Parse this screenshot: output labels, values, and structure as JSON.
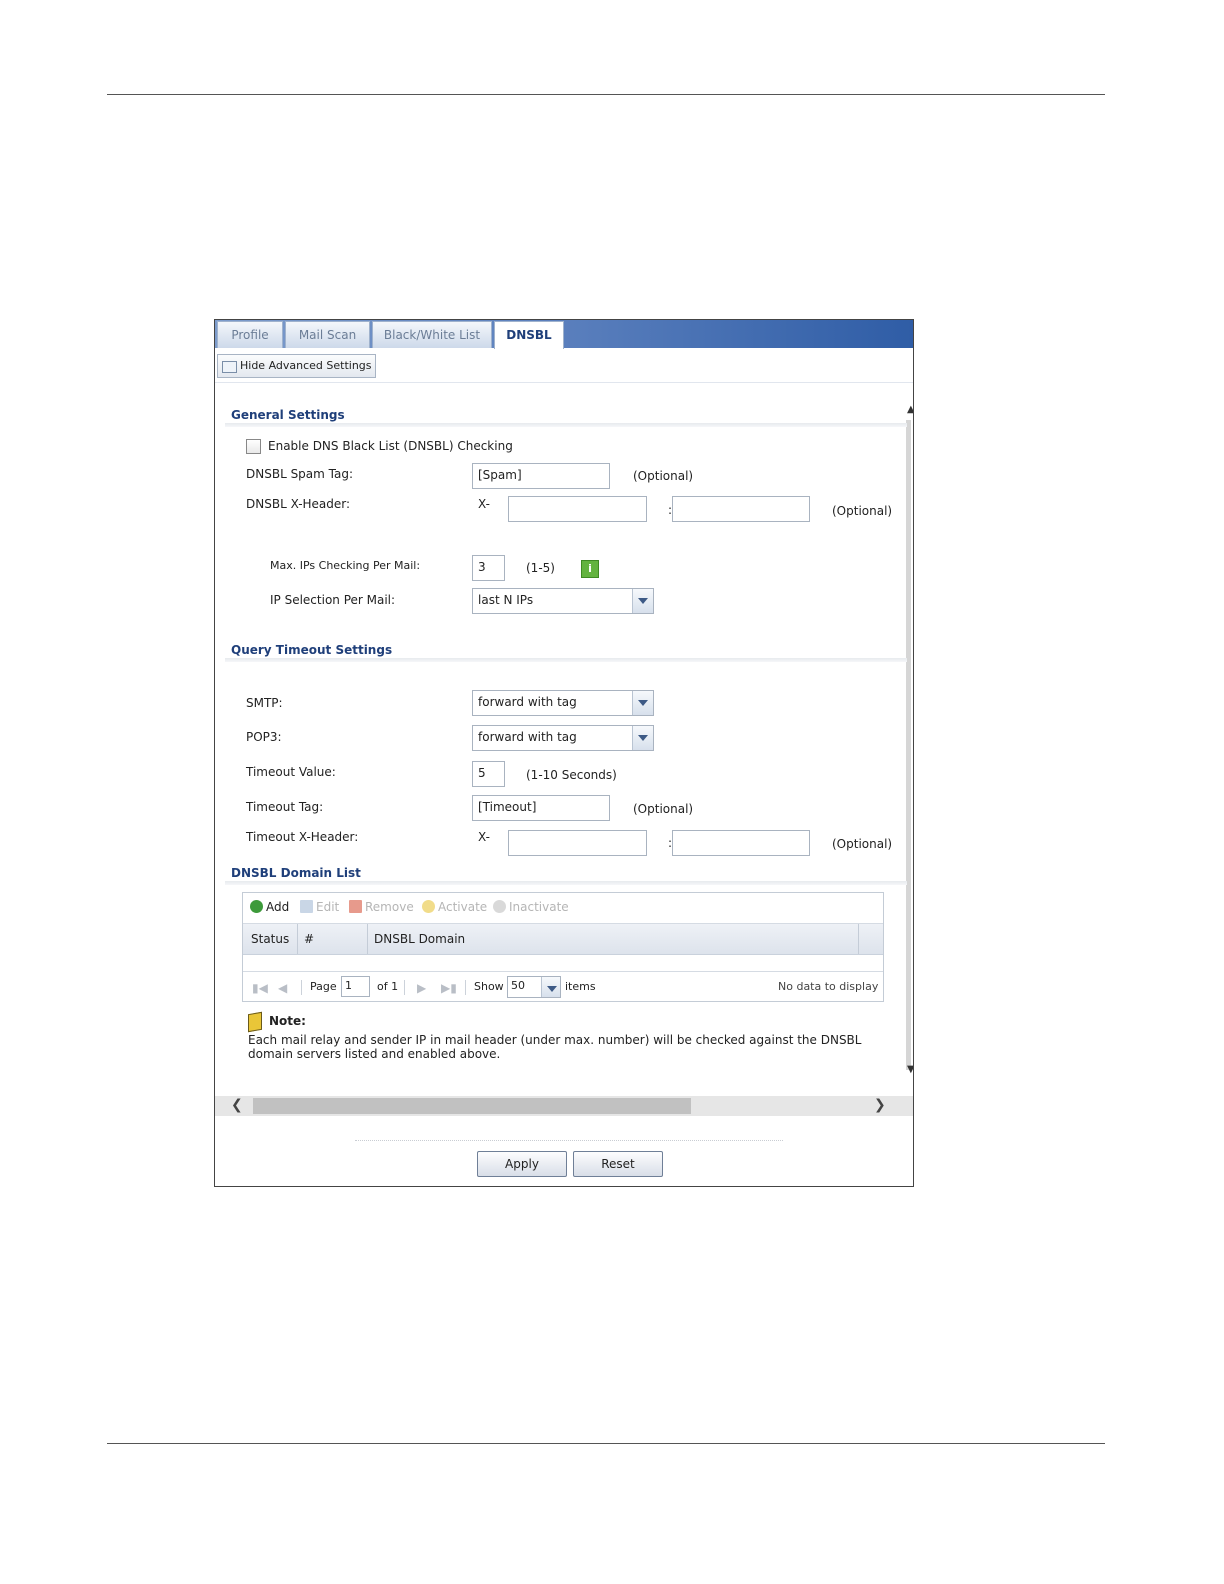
{
  "tabs": [
    {
      "label": "Profile"
    },
    {
      "label": "Mail Scan"
    },
    {
      "label": "Black/White List"
    },
    {
      "label": "DNSBL",
      "active": true
    }
  ],
  "toolbar": {
    "advanced_label": "Hide Advanced Settings"
  },
  "general": {
    "title": "General Settings",
    "enable_label": "Enable DNS Black List (DNSBL) Checking",
    "enable_checked": false,
    "spam_tag_label": "DNSBL Spam Tag:",
    "spam_tag_value": "[Spam]",
    "spam_tag_hint": "(Optional)",
    "xheader_label": "DNSBL X-Header:",
    "xheader_prefix": "X-",
    "xheader_name": "",
    "xheader_sep": ":",
    "xheader_value": "",
    "xheader_hint": "(Optional)",
    "max_ips_label": "Max. IPs Checking Per Mail:",
    "max_ips_value": "3",
    "max_ips_hint": "(1-5)",
    "info_icon_glyph": "i",
    "ip_selection_label": "IP Selection Per Mail:",
    "ip_selection_value": "last N IPs"
  },
  "timeout": {
    "title": "Query Timeout Settings",
    "smtp_label": "SMTP:",
    "smtp_value": "forward with tag",
    "pop3_label": "POP3:",
    "pop3_value": "forward with tag",
    "timeout_value_label": "Timeout Value:",
    "timeout_value": "5",
    "timeout_value_hint": "(1-10 Seconds)",
    "timeout_tag_label": "Timeout Tag:",
    "timeout_tag_value": "[Timeout]",
    "timeout_tag_hint": "(Optional)",
    "xheader_label": "Timeout X-Header:",
    "xheader_prefix": "X-",
    "xheader_name": "",
    "xheader_sep": ":",
    "xheader_value": "",
    "xheader_hint": "(Optional)"
  },
  "domain_list": {
    "title": "DNSBL Domain List",
    "tools": {
      "add": "Add",
      "edit": "Edit",
      "remove": "Remove",
      "activate": "Activate",
      "inactivate": "Inactivate"
    },
    "columns": [
      "Status",
      "#",
      "DNSBL Domain"
    ],
    "rows": [],
    "pager": {
      "page_label": "Page",
      "page_value": "1",
      "of_label": "of 1",
      "show_label": "Show",
      "show_value": "50",
      "items_label": "items",
      "empty_text": "No data to display"
    }
  },
  "note": {
    "title": "Note:",
    "text": "Each mail relay and sender IP in mail header (under max. number) will be checked against the DNSBL domain servers listed and enabled above."
  },
  "buttons": {
    "apply": "Apply",
    "reset": "Reset"
  },
  "colors": {
    "accent": "#1f3f7a",
    "tabbar": "#2f5da6",
    "info": "#63b33f",
    "add_icon": "#3d9a3a"
  }
}
